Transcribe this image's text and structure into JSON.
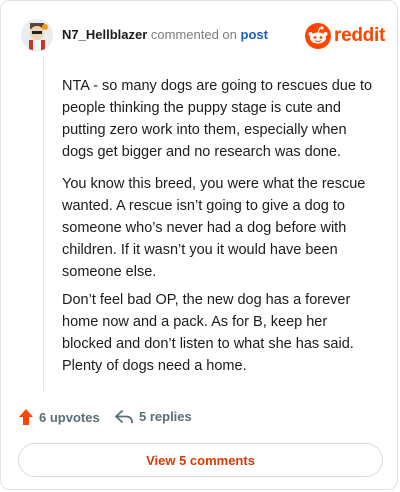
{
  "header": {
    "username": "N7_Hellblazer",
    "commented_on": "commented on",
    "post_link": "post",
    "brand": "reddit"
  },
  "comment": {
    "paragraphs": [
      "NTA - so many dogs are going to rescues due to people thinking the puppy stage is cute and putting zero work into them, especially when dogs get bigger and no research was done.",
      "You know this breed, you were what the rescue wanted. A rescue isn’t going to give a dog to someone who’s never had a dog before with children. If it wasn’t you it would have been someone else.",
      "Don’t feel bad OP, the new dog has a forever home now and a pack. As for B, keep her blocked and don’t listen to what she has said. Plenty of dogs need a home."
    ]
  },
  "actions": {
    "upvotes": "6 upvotes",
    "replies": "5 replies",
    "view_comments": "View 5 comments"
  },
  "colors": {
    "brand": "#ff4500",
    "link": "#1a5fbd",
    "cta": "#d93a00"
  }
}
